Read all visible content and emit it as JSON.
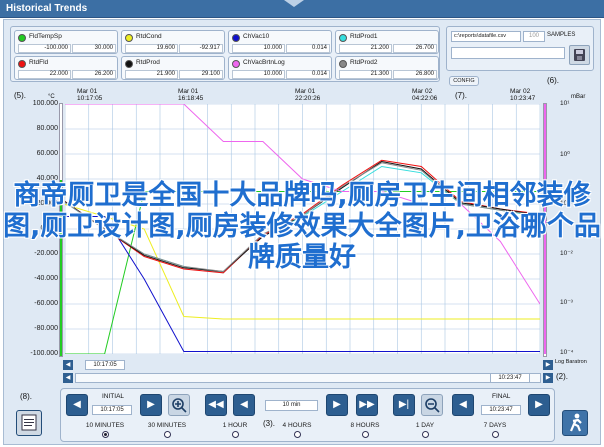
{
  "window": {
    "title": "Historical Trends"
  },
  "tags": [
    {
      "name": "FldTempSp",
      "color": "#22cc22",
      "v1": "-100.000",
      "v2": "30.000"
    },
    {
      "name": "RtdCond",
      "color": "#eeee22",
      "v1": "19.600",
      "v2": "-92.917"
    },
    {
      "name": "ChVac10",
      "color": "#1111cc",
      "v1": "10.000",
      "v2": "0.014"
    },
    {
      "name": "RtdProd1",
      "color": "#33dddd",
      "v1": "21.200",
      "v2": "26.700"
    },
    {
      "name": "RtdFld",
      "color": "#ee1111",
      "v1": "22.000",
      "v2": "26.200"
    },
    {
      "name": "RtdProd",
      "color": "#111111",
      "v1": "21.900",
      "v2": "29.100"
    },
    {
      "name": "ChVacBrtnLog",
      "color": "#ee66ee",
      "v1": "10.000",
      "v2": "0.014"
    },
    {
      "name": "RtdProd2",
      "color": "#888888",
      "v1": "21.300",
      "v2": "26.800"
    }
  ],
  "file_panel": {
    "path": "c:\\reports\\datafile.csv",
    "samples_value": "100",
    "samples_label": "SAMPLES"
  },
  "config_label": "CONFIG",
  "callouts": {
    "c5": "(5).",
    "c7": "(7).",
    "c6": "(6).",
    "c8": "(8).",
    "c2": "(2).",
    "c3": "(3)."
  },
  "units": {
    "left": "°C",
    "right": "mBar"
  },
  "time_header": [
    {
      "date": "Mar 01",
      "time": "10:17:05"
    },
    {
      "date": "Mar 01",
      "time": "16:18:45"
    },
    {
      "date": "Mar 01",
      "time": "22:20:26"
    },
    {
      "date": "Mar 02",
      "time": "04:22:06"
    },
    {
      "date": "Mar 02",
      "time": "10:23:47"
    }
  ],
  "y_left_ticks": [
    "100.000",
    "80.000",
    "60.000",
    "40.000",
    "20.000",
    "0.000",
    "-20.000",
    "-40.000",
    "-60.000",
    "-80.000",
    "-100.000"
  ],
  "y_right_ticks": [
    "10¹",
    "10⁰",
    "10⁻¹",
    "10⁻²",
    "10⁻³",
    "10⁻⁴"
  ],
  "scroll": {
    "start": "10:17:05",
    "end": "10:23:47",
    "log_label": "Log Baratron"
  },
  "controls": {
    "initial_label": "INITIAL",
    "initial_time": "10:17:05",
    "span": "10 min",
    "final_label": "FINAL",
    "final_time": "10:23:47",
    "ranges": [
      "10 MINUTES",
      "30 MINUTES",
      "1 HOUR",
      "4 HOURS",
      "8 HOURS",
      "1 DAY",
      "7 DAYS"
    ]
  },
  "overlay_text": "商帝厕卫是全国十大品牌吗,厕房卫生间相邻装修图,厕卫设计图,厕房装修效果大全图片,卫浴哪个品牌质量好",
  "chart_data": {
    "type": "line",
    "x": [
      0,
      2,
      4,
      6,
      8,
      10,
      12,
      14,
      16,
      18,
      20,
      22,
      24
    ],
    "series": [
      {
        "name": "FldTempSp",
        "color": "#22cc22",
        "values": [
          -100,
          -100,
          30,
          30,
          30,
          30,
          30,
          30,
          30,
          30,
          30,
          30,
          30
        ]
      },
      {
        "name": "RtdCond",
        "color": "#eeee22",
        "values": [
          19.6,
          10,
          0,
          -70,
          -72,
          -72,
          -72,
          -72,
          -72,
          -72,
          -72,
          -72,
          -72
        ]
      },
      {
        "name": "ChVac10",
        "color": "#1111cc",
        "values": [
          10,
          10,
          -40,
          -98,
          -98,
          -98,
          -98,
          -98,
          -98,
          -98,
          -98,
          -98,
          -98
        ]
      },
      {
        "name": "RtdProd1",
        "color": "#33dddd",
        "values": [
          21.2,
          0,
          -20,
          -30,
          -35,
          -5,
          10,
          30,
          50,
          45,
          20,
          15,
          10
        ]
      },
      {
        "name": "RtdFld",
        "color": "#ee1111",
        "values": [
          22,
          0,
          -22,
          -32,
          -35,
          -5,
          12,
          35,
          55,
          50,
          22,
          16,
          12
        ]
      },
      {
        "name": "RtdProd",
        "color": "#111111",
        "values": [
          21.9,
          0,
          -21,
          -31,
          -34,
          -6,
          11,
          33,
          54,
          48,
          21,
          16,
          11
        ]
      },
      {
        "name": "ChVacBrtnLog",
        "color": "#ee66ee",
        "values": [
          100,
          100,
          100,
          100,
          70,
          70,
          40,
          30,
          30,
          20,
          20,
          -10,
          -60
        ]
      },
      {
        "name": "RtdProd2",
        "color": "#888888",
        "values": [
          21.3,
          0,
          -20,
          -30,
          -34,
          -4,
          11,
          34,
          53,
          47,
          20,
          15,
          11
        ]
      }
    ],
    "ylim": [
      -100,
      100
    ]
  }
}
